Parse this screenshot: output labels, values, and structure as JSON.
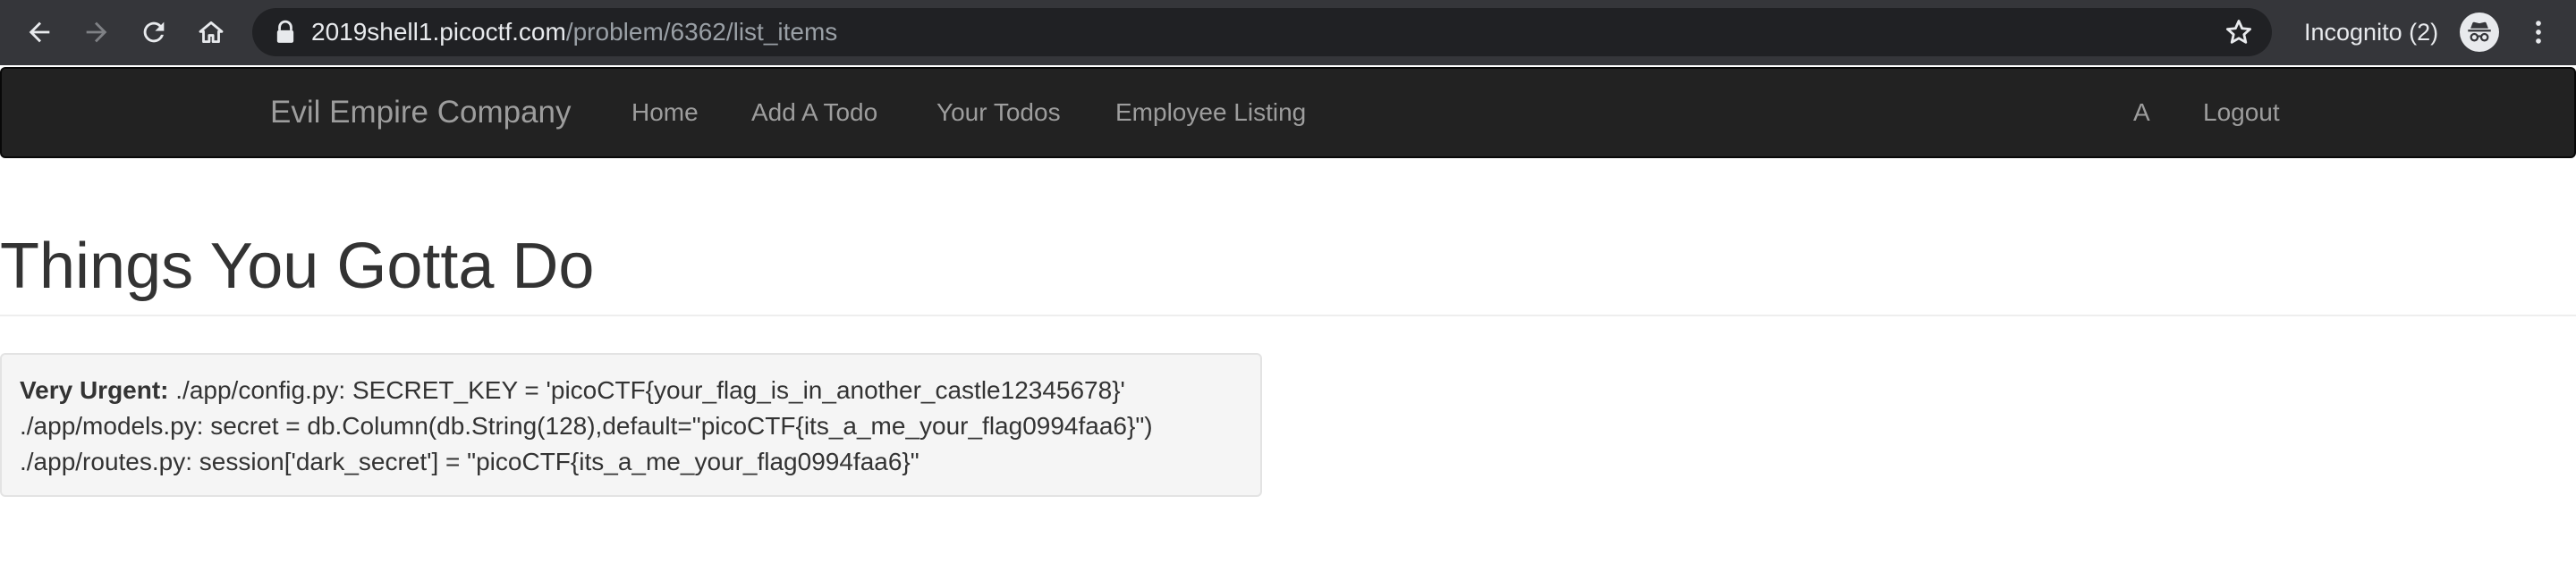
{
  "browser": {
    "url_host": "2019shell1.picoctf.com",
    "url_path": "/problem/6362/list_items",
    "incognito_label": "Incognito (2)",
    "icons": {
      "back": "arrow-left-icon",
      "forward": "arrow-right-icon",
      "reload": "reload-icon",
      "home": "home-icon",
      "secure": "lock-icon",
      "bookmark": "star-icon",
      "incognito": "incognito-icon",
      "menu": "kebab-menu-icon"
    }
  },
  "navbar": {
    "brand": "Evil Empire Company",
    "links": [
      "Home",
      "Add A Todo",
      "Your Todos",
      "Employee Listing"
    ],
    "user": "A",
    "logout": "Logout"
  },
  "page": {
    "title": "Things You Gotta Do"
  },
  "todo": {
    "label": "Very Urgent:",
    "lines": [
      " ./app/config.py: SECRET_KEY = 'picoCTF{your_flag_is_in_another_castle12345678}'",
      "./app/models.py: secret = db.Column(db.String(128),default=\"picoCTF{its_a_me_your_flag0994faa6}\")",
      "./app/routes.py: session['dark_secret'] = \"picoCTF{its_a_me_your_flag0994faa6}\""
    ]
  },
  "colors": {
    "chrome_bg": "#35363a",
    "omnibox_bg": "#202124",
    "navbar_bg": "#222222",
    "nav_link": "#9d9d9d",
    "well_bg": "#f5f5f5",
    "text": "#333333"
  }
}
